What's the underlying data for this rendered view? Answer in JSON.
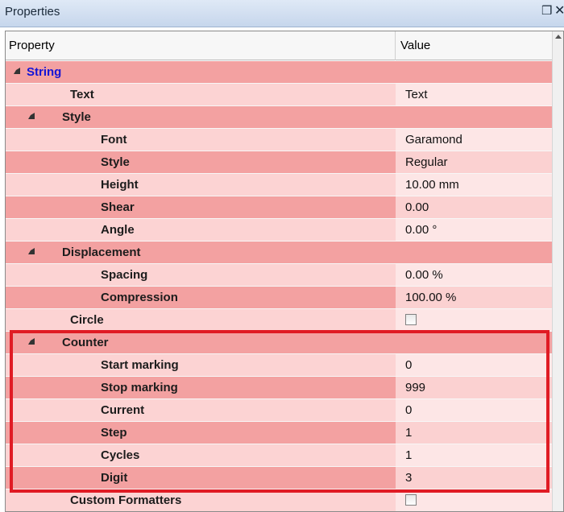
{
  "window": {
    "title": "Properties",
    "pin_icon": "pin-icon",
    "close_icon": "close-icon"
  },
  "header": {
    "property_col": "Property",
    "value_col": "Value"
  },
  "rows": [
    {
      "label": "String",
      "value": "",
      "level": 0,
      "category": true
    },
    {
      "label": "Text",
      "value": "Text",
      "level": 1
    },
    {
      "label": "Style",
      "value": "",
      "level": 1,
      "category": true
    },
    {
      "label": "Font",
      "value": "Garamond",
      "level": 2
    },
    {
      "label": "Style",
      "value": "Regular",
      "level": 2
    },
    {
      "label": "Height",
      "value": "10.00 mm",
      "level": 2
    },
    {
      "label": "Shear",
      "value": "0.00",
      "level": 2
    },
    {
      "label": "Angle",
      "value": "0.00 °",
      "level": 2
    },
    {
      "label": "Displacement",
      "value": "",
      "level": 1,
      "category": true
    },
    {
      "label": "Spacing",
      "value": "0.00 %",
      "level": 2
    },
    {
      "label": "Compression",
      "value": "100.00 %",
      "level": 2
    },
    {
      "label": "Circle",
      "value": "",
      "level": 1,
      "checkbox": true,
      "checked": false
    },
    {
      "label": "Counter",
      "value": "",
      "level": 1,
      "category": true
    },
    {
      "label": "Start marking",
      "value": "0",
      "level": 2
    },
    {
      "label": "Stop marking",
      "value": "999",
      "level": 2
    },
    {
      "label": "Current",
      "value": "0",
      "level": 2
    },
    {
      "label": "Step",
      "value": "1",
      "level": 2
    },
    {
      "label": "Cycles",
      "value": "1",
      "level": 2
    },
    {
      "label": "Digit",
      "value": "3",
      "level": 2
    },
    {
      "label": "Custom Formatters",
      "value": "",
      "level": 1,
      "checkbox": true,
      "checked": false
    }
  ],
  "colors": {
    "row_dark": "#f3a1a1",
    "row_light": "#fcd3d3",
    "category_label_root": "#1414d6",
    "highlight_border": "#e01b24"
  }
}
